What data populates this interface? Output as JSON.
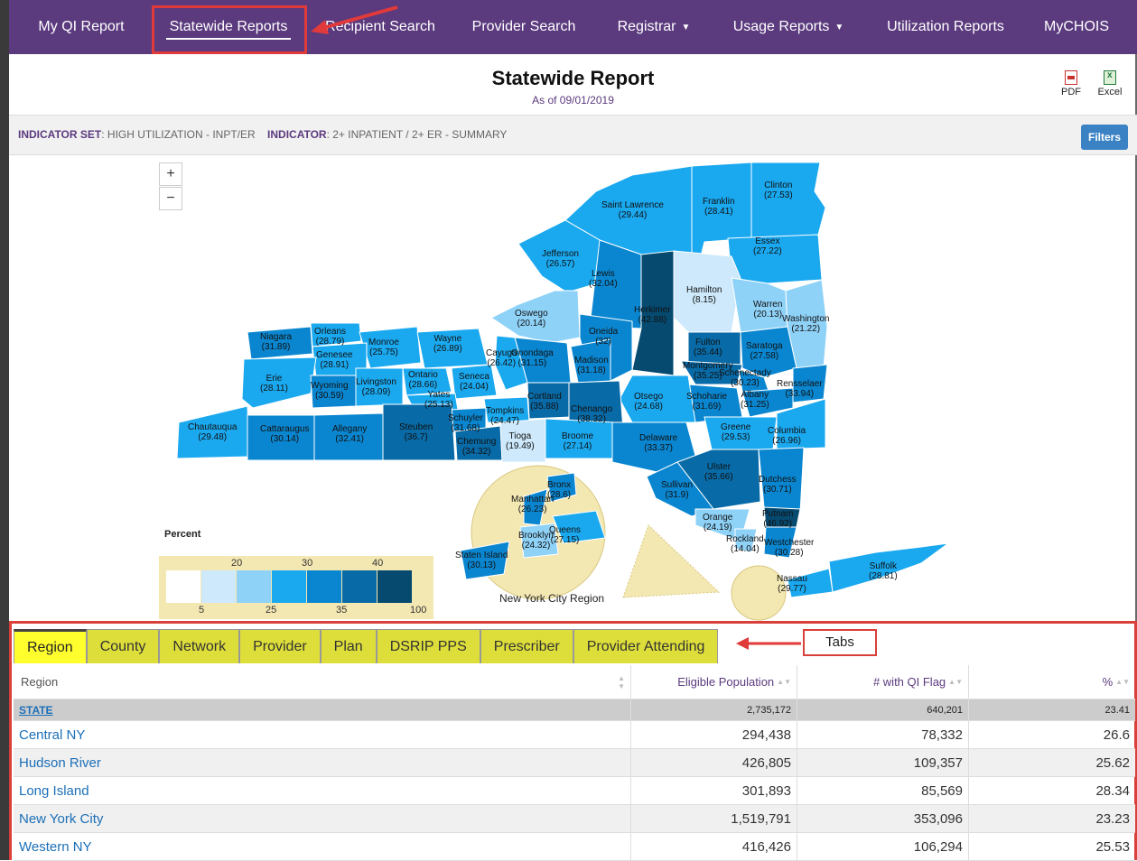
{
  "nav": {
    "items": [
      {
        "label": "My QI Report"
      },
      {
        "label": "Statewide Reports"
      },
      {
        "label": "Recipient Search"
      },
      {
        "label": "Provider Search"
      },
      {
        "label": "Registrar"
      },
      {
        "label": "Usage Reports"
      },
      {
        "label": "Utilization Reports"
      },
      {
        "label": "MyCHOIS"
      }
    ]
  },
  "header": {
    "title": "Statewide Report",
    "as_of": "As of 09/01/2019",
    "pdf_label": "PDF",
    "excel_label": "Excel"
  },
  "indicator": {
    "set_label": "INDICATOR SET",
    "set_value": ": HIGH UTILIZATION - INPT/ER",
    "ind_label": "INDICATOR",
    "ind_value": ": 2+ INPATIENT / 2+ ER - SUMMARY",
    "filters_label": "Filters"
  },
  "map": {
    "zoom_in": "+",
    "zoom_out": "−",
    "legend_title": "Percent",
    "legend_top": [
      "20",
      "30",
      "40"
    ],
    "legend_bottom": [
      "5",
      "25",
      "35",
      "100"
    ],
    "nyc_region_label": "New York City Region",
    "colors": [
      "#ffffff",
      "#cde9fb",
      "#8fd2f8",
      "#1aa8ef",
      "#0a86d0",
      "#086aa6",
      "#064a70"
    ],
    "counties": [
      {
        "name": "Clinton",
        "value": "(27.53)"
      },
      {
        "name": "Franklin",
        "value": "(28.41)"
      },
      {
        "name": "Saint Lawrence",
        "value": "(29.44)"
      },
      {
        "name": "Essex",
        "value": "(27.22)"
      },
      {
        "name": "Jefferson",
        "value": "(26.57)"
      },
      {
        "name": "Lewis",
        "value": "(32.04)"
      },
      {
        "name": "Hamilton",
        "value": "(8.15)"
      },
      {
        "name": "Warren",
        "value": "(20.13)"
      },
      {
        "name": "Washington",
        "value": "(21.22)"
      },
      {
        "name": "Oswego",
        "value": "(20.14)"
      },
      {
        "name": "Herkimer",
        "value": "(42.88)"
      },
      {
        "name": "Niagara",
        "value": "(31.89)"
      },
      {
        "name": "Orleans",
        "value": "(28.79)"
      },
      {
        "name": "Monroe",
        "value": "(25.75)"
      },
      {
        "name": "Wayne",
        "value": "(26.89)"
      },
      {
        "name": "Oneida",
        "value": "(32)"
      },
      {
        "name": "Fulton",
        "value": "(35.44)"
      },
      {
        "name": "Saratoga",
        "value": "(27.58)"
      },
      {
        "name": "Genesee",
        "value": "(28.91)"
      },
      {
        "name": "Cayuga",
        "value": "(26.42)"
      },
      {
        "name": "Onondaga",
        "value": "(31.15)"
      },
      {
        "name": "Madison",
        "value": "(31.18)"
      },
      {
        "name": "Montgomery",
        "value": "(35.25)"
      },
      {
        "name": "Schenectady",
        "value": "(30.23)"
      },
      {
        "name": "Rensselaer",
        "value": "(33.94)"
      },
      {
        "name": "Erie",
        "value": "(28.11)"
      },
      {
        "name": "Wyoming",
        "value": "(30.59)"
      },
      {
        "name": "Livingston",
        "value": "(28.09)"
      },
      {
        "name": "Ontario",
        "value": "(28.66)"
      },
      {
        "name": "Seneca",
        "value": "(24.04)"
      },
      {
        "name": "Yates",
        "value": "(25.13)"
      },
      {
        "name": "Cortland",
        "value": "(35.88)"
      },
      {
        "name": "Otsego",
        "value": "(24.68)"
      },
      {
        "name": "Schoharie",
        "value": "(31.69)"
      },
      {
        "name": "Albany",
        "value": "(31.25)"
      },
      {
        "name": "Chenango",
        "value": "(38.32)"
      },
      {
        "name": "Tompkins",
        "value": "(24.47)"
      },
      {
        "name": "Schuyler",
        "value": "(31.68)"
      },
      {
        "name": "Chautauqua",
        "value": "(29.48)"
      },
      {
        "name": "Cattaraugus",
        "value": "(30.14)"
      },
      {
        "name": "Allegany",
        "value": "(32.41)"
      },
      {
        "name": "Steuben",
        "value": "(36.7)"
      },
      {
        "name": "Chemung",
        "value": "(34.32)"
      },
      {
        "name": "Tioga",
        "value": "(19.49)"
      },
      {
        "name": "Broome",
        "value": "(27.14)"
      },
      {
        "name": "Delaware",
        "value": "(33.37)"
      },
      {
        "name": "Greene",
        "value": "(29.53)"
      },
      {
        "name": "Columbia",
        "value": "(26.96)"
      },
      {
        "name": "Ulster",
        "value": "(35.66)"
      },
      {
        "name": "Sullivan",
        "value": "(31.9)"
      },
      {
        "name": "Dutchess",
        "value": "(30.71)"
      },
      {
        "name": "Orange",
        "value": "(24.19)"
      },
      {
        "name": "Putnam",
        "value": "(46.92)"
      },
      {
        "name": "Rockland",
        "value": "(14.04)"
      },
      {
        "name": "Westchester",
        "value": "(30.28)"
      },
      {
        "name": "Bronx",
        "value": "(28.6)"
      },
      {
        "name": "Manhattan",
        "value": "(26.23)"
      },
      {
        "name": "Queens",
        "value": "(27.15)"
      },
      {
        "name": "Brooklyn",
        "value": "(24.32)"
      },
      {
        "name": "Staten Island",
        "value": "(30.13)"
      },
      {
        "name": "Nassau",
        "value": "(29.77)"
      },
      {
        "name": "Suffolk",
        "value": "(28.81)"
      }
    ]
  },
  "tabs": {
    "items": [
      {
        "label": "Region"
      },
      {
        "label": "County"
      },
      {
        "label": "Network"
      },
      {
        "label": "Provider"
      },
      {
        "label": "Plan"
      },
      {
        "label": "DSRIP PPS"
      },
      {
        "label": "Prescriber"
      },
      {
        "label": "Provider Attending"
      }
    ],
    "annotation": "Tabs"
  },
  "table": {
    "headers": [
      "Region",
      "Eligible Population",
      "# with QI Flag",
      "%"
    ],
    "state_row": [
      "STATE",
      "2,735,172",
      "640,201",
      "23.41"
    ],
    "rows": [
      [
        "Central NY",
        "294,438",
        "78,332",
        "26.6"
      ],
      [
        "Hudson River",
        "426,805",
        "109,357",
        "25.62"
      ],
      [
        "Long Island",
        "301,893",
        "85,569",
        "28.34"
      ],
      [
        "New York City",
        "1,519,791",
        "353,096",
        "23.23"
      ],
      [
        "Western NY",
        "416,426",
        "106,294",
        "25.53"
      ]
    ]
  }
}
